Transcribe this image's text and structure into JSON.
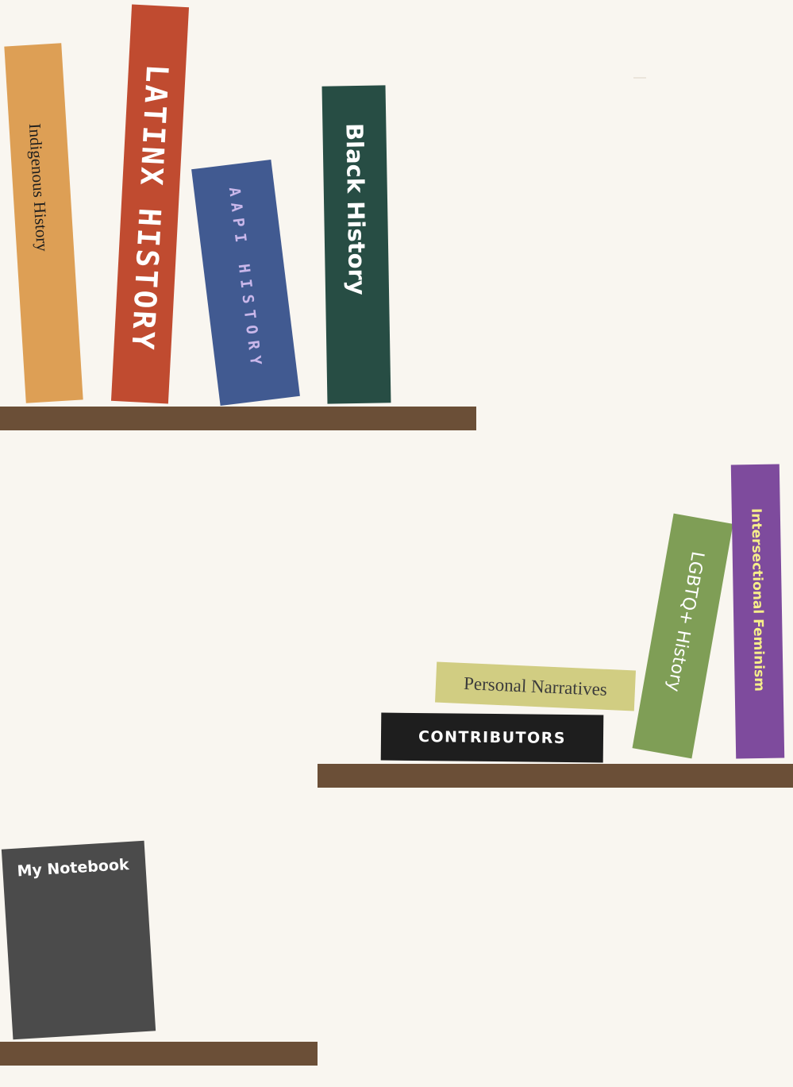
{
  "colors": {
    "background": "#f9f6f0",
    "shelf": "#6b4f37"
  },
  "books": {
    "indigenous_history": {
      "label": "Indigenous History",
      "color": "#dd9f55",
      "text_color": "#1e1e1e"
    },
    "latinx_history": {
      "label": "LATINX HISTORY",
      "color": "#c04b30",
      "text_color": "#ffffff"
    },
    "aapi_history": {
      "label": "AAPI HISTORY",
      "color": "#415a91",
      "text_color": "#c9b7ea"
    },
    "black_history": {
      "label": "Black History",
      "color": "#274d44",
      "text_color": "#ffffff"
    },
    "personal_narratives": {
      "label": "Personal Narratives",
      "color": "#d1cd82",
      "text_color": "#3c3c3c"
    },
    "contributors": {
      "label": "CONTRIBUTORS",
      "color": "#1e1e1e",
      "text_color": "#ffffff"
    },
    "lgbtq_history": {
      "label": "LGBTQ+ History",
      "color": "#7f9e56",
      "text_color": "#ffffff"
    },
    "intersectional_feminism": {
      "label": "Intersectional Feminism",
      "color": "#7e4b9d",
      "text_color": "#f6ee8a"
    },
    "my_notebook": {
      "label": "My Notebook",
      "color": "#4b4b4b",
      "text_color": "#ffffff"
    }
  }
}
